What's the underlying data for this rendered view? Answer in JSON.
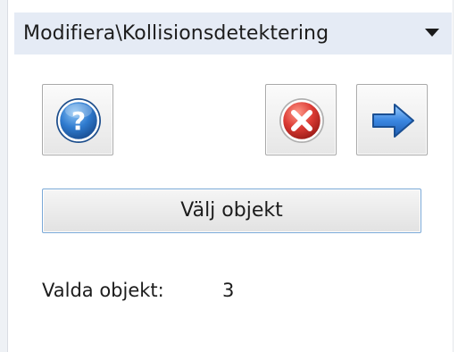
{
  "header": {
    "title": "Modifiera\\Kollisionsdetektering",
    "dropdown_icon": "triangle-down-icon"
  },
  "toolbar": {
    "help_icon": "help-icon",
    "cancel_icon": "cancel-icon",
    "next_icon": "arrow-right-icon"
  },
  "select_button": {
    "label": "Välj objekt"
  },
  "selection": {
    "label": "Valda objekt:",
    "count": "3"
  },
  "colors": {
    "header_background": "#e5ebf5",
    "help_blue": "#2a6fb8",
    "cancel_red": "#d33a3a",
    "arrow_blue": "#3a86e0",
    "focus_border": "#7aa8d6"
  }
}
